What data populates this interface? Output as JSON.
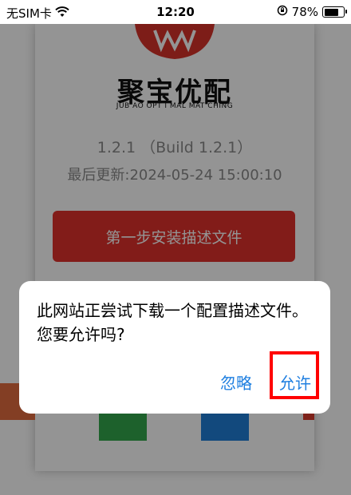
{
  "status_bar": {
    "carrier": "无SIM卡",
    "time": "12:20",
    "battery_percent": "78%",
    "battery_level": 0.78
  },
  "page": {
    "brand_name": "聚宝优配",
    "brand_sub": "JUB AO OPT I MAL MAT CHING",
    "version": "1.2.1 （Build 1.2.1）",
    "updated": "最后更新:2024-05-24 15:00:10",
    "step_button": "第一步安装描述文件"
  },
  "alert": {
    "message": "此网站正尝试下载一个配置描述文件。您要允许吗?",
    "ignore_label": "忽略",
    "allow_label": "允许"
  },
  "colors": {
    "accent": "#1f7fe0",
    "primary_red": "#e0312b",
    "highlight": "#ff0000"
  }
}
